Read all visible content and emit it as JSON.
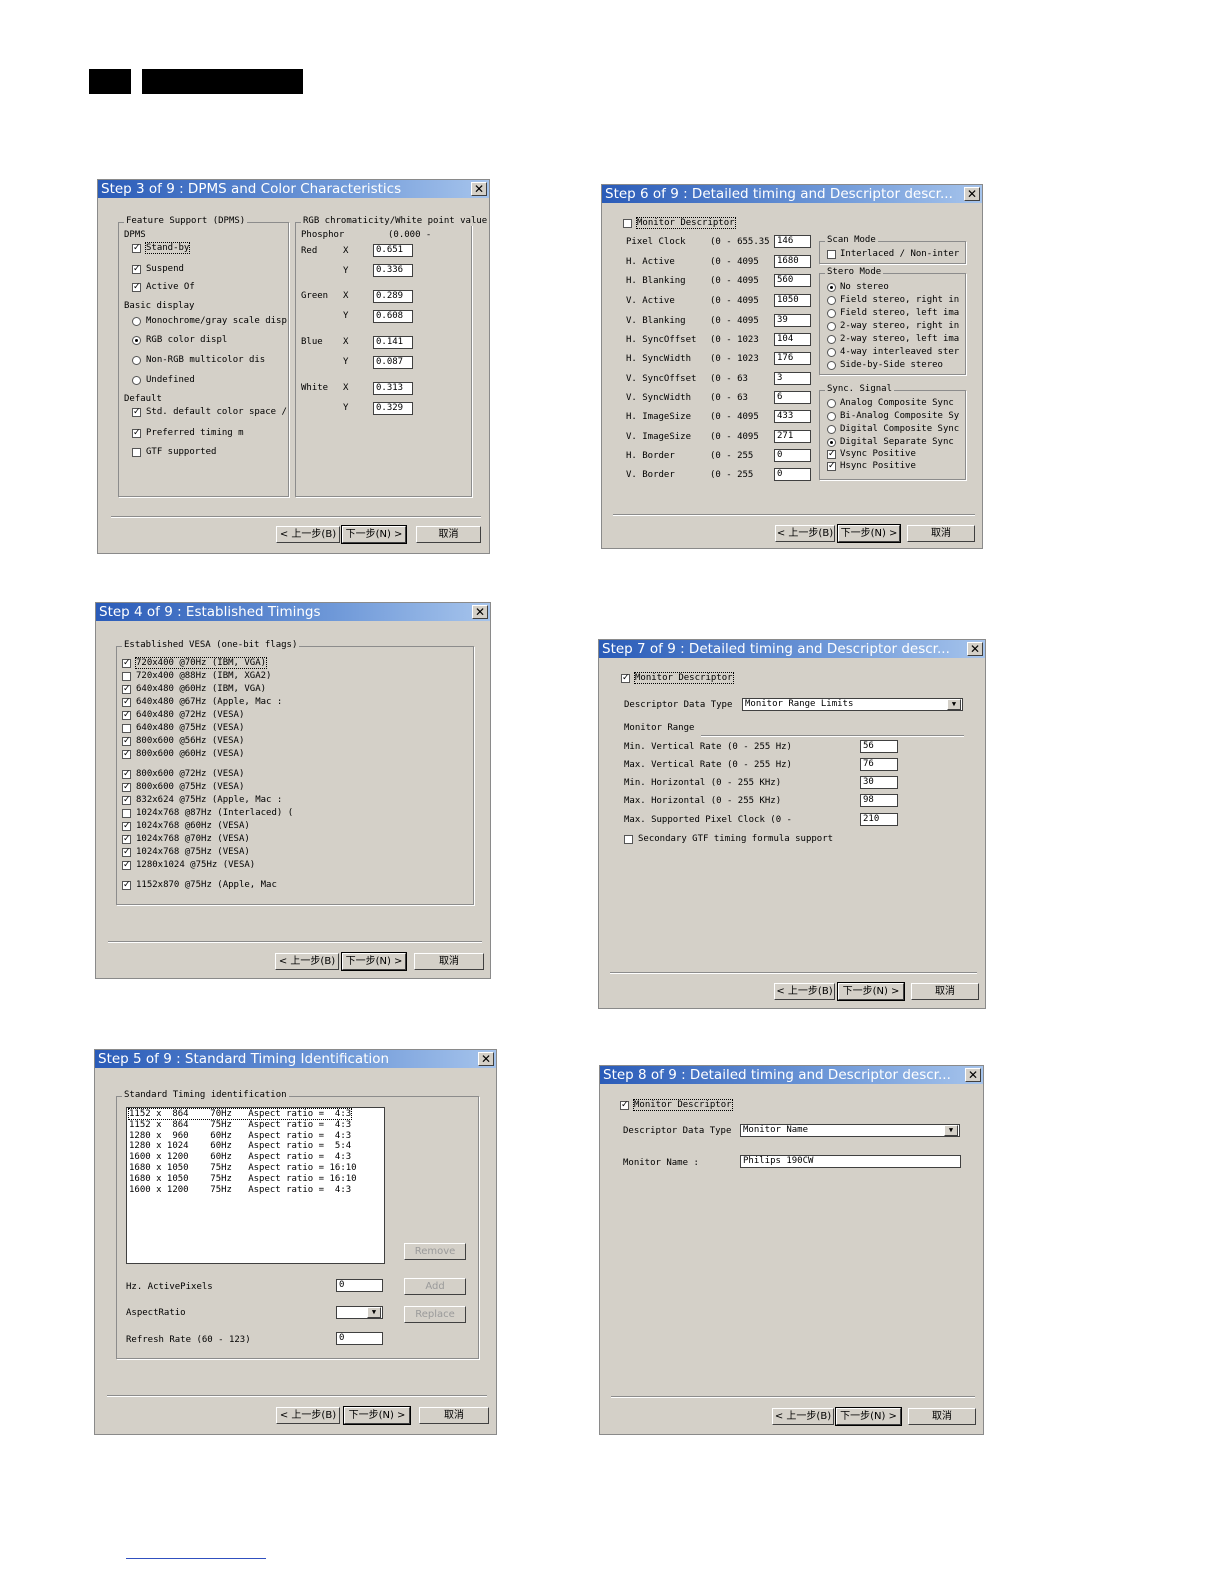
{
  "buttons": {
    "back": "< 上一步(B)",
    "next": "下一步(N) >",
    "cancel": "取消"
  },
  "step3": {
    "title": "Step 3 of 9 : DPMS and Color Characteristics",
    "feature_support": "Feature Support (DPMS)",
    "dpms": "DPMS",
    "standby": "Stand-by",
    "suspend": "Suspend",
    "active_off": "Active Of",
    "basic_display": "Basic display",
    "mono": "Monochrome/gray scale disp",
    "rgb": "RGB color displ",
    "nonrgb": "Non-RGB multicolor dis",
    "undefined": "Undefined",
    "default": "Default",
    "std_default": "Std. default color space /",
    "preferred": "Preferred timing m",
    "gtf": "GTF supported",
    "chroma_group": "RGB chromaticity/White point value",
    "phosphor": "Phosphor",
    "range": "(0.000 -",
    "red": "Red",
    "green": "Green",
    "blue": "Blue",
    "white": "White",
    "x": "X",
    "y": "Y",
    "red_x": "0.651",
    "red_y": "0.336",
    "green_x": "0.289",
    "green_y": "0.608",
    "blue_x": "0.141",
    "blue_y": "0.087",
    "white_x": "0.313",
    "white_y": "0.329"
  },
  "step4": {
    "title": "Step 4 of 9 : Established Timings",
    "group": "Established VESA (one-bit flags)",
    "items": [
      {
        "label": "720x400 @70Hz (IBM, VGA)",
        "checked": true
      },
      {
        "label": "720x400 @88Hz (IBM, XGA2)",
        "checked": false
      },
      {
        "label": "640x480 @60Hz (IBM, VGA)",
        "checked": true
      },
      {
        "label": "640x480 @67Hz (Apple, Mac :",
        "checked": true
      },
      {
        "label": "640x480 @72Hz (VESA)",
        "checked": true
      },
      {
        "label": "640x480 @75Hz (VESA)",
        "checked": false
      },
      {
        "label": "800x600 @56Hz (VESA)",
        "checked": true
      },
      {
        "label": "800x600 @60Hz (VESA)",
        "checked": true
      },
      {
        "label": "800x600 @72Hz (VESA)",
        "checked": true
      },
      {
        "label": "800x600 @75Hz (VESA)",
        "checked": true
      },
      {
        "label": "832x624 @75Hz (Apple, Mac :",
        "checked": true
      },
      {
        "label": "1024x768 @87Hz (Interlaced) (",
        "checked": false
      },
      {
        "label": "1024x768 @60Hz (VESA)",
        "checked": true
      },
      {
        "label": "1024x768 @70Hz (VESA)",
        "checked": true
      },
      {
        "label": "1024x768 @75Hz (VESA)",
        "checked": true
      },
      {
        "label": "1280x1024 @75Hz (VESA)",
        "checked": true
      },
      {
        "label": "1152x870 @75Hz (Apple, Mac",
        "checked": true
      }
    ]
  },
  "step5": {
    "title": "Step 5 of 9 : Standard Timing Identification",
    "group": "Standard Timing identification",
    "rows": [
      "1152 x  864    70Hz   Aspect ratio =  4:3",
      "1152 x  864    75Hz   Aspect ratio =  4:3",
      "1280 x  960    60Hz   Aspect ratio =  4:3",
      "1280 x 1024    60Hz   Aspect ratio =  5:4",
      "1600 x 1200    60Hz   Aspect ratio =  4:3",
      "1680 x 1050    75Hz   Aspect ratio = 16:10",
      "1680 x 1050    75Hz   Aspect ratio = 16:10",
      "1600 x 1200    75Hz   Aspect ratio =  4:3"
    ],
    "remove": "Remove",
    "hz_active": "Hz. ActivePixels",
    "hz_value": "0",
    "add": "Add",
    "aspect": "AspectRatio",
    "replace": "Replace",
    "refresh": "Refresh Rate (60 - 123)",
    "refresh_value": "0"
  },
  "step6": {
    "title": "Step 6 of 9 : Detailed timing and Descriptor descr...",
    "monitor_descriptor": "Monitor Descriptor",
    "params": [
      {
        "label": "Pixel Clock",
        "range": "(0 - 655.35",
        "value": "146"
      },
      {
        "label": "H. Active",
        "range": "(0 - 4095",
        "value": "1680"
      },
      {
        "label": "H. Blanking",
        "range": "(0 - 4095",
        "value": "560"
      },
      {
        "label": "V. Active",
        "range": "(0 - 4095",
        "value": "1050"
      },
      {
        "label": "V. Blanking",
        "range": "(0 - 4095",
        "value": "39"
      },
      {
        "label": "H. SyncOffset",
        "range": "(0 - 1023",
        "value": "104"
      },
      {
        "label": "H. SyncWidth",
        "range": "(0 - 1023",
        "value": "176"
      },
      {
        "label": "V. SyncOffset",
        "range": "(0 - 63",
        "value": "3"
      },
      {
        "label": "V. SyncWidth",
        "range": "(0 - 63",
        "value": "6"
      },
      {
        "label": "H. ImageSize",
        "range": "(0 - 4095",
        "value": "433"
      },
      {
        "label": "V. ImageSize",
        "range": "(0 - 4095",
        "value": "271"
      },
      {
        "label": "H. Border",
        "range": "(0 - 255",
        "value": "0"
      },
      {
        "label": "V. Border",
        "range": "(0 - 255",
        "value": "0"
      }
    ],
    "scan_mode": "Scan Mode",
    "interlaced": "Interlaced / Non-inter",
    "stereo_mode": "Stero Mode",
    "stereo": [
      {
        "label": "No stereo",
        "on": true
      },
      {
        "label": "Field stereo, right in",
        "on": false
      },
      {
        "label": "Field stereo, left ima",
        "on": false
      },
      {
        "label": "2-way stereo, right in",
        "on": false
      },
      {
        "label": "2-way stereo, left ima",
        "on": false
      },
      {
        "label": "4-way interleaved ster",
        "on": false
      },
      {
        "label": "Side-by-Side stereo",
        "on": false
      }
    ],
    "sync_signal": "Sync. Signal",
    "sync": [
      {
        "label": "Analog Composite Sync",
        "on": false
      },
      {
        "label": "Bi-Analog Composite Sy",
        "on": false
      },
      {
        "label": "Digital Composite Sync",
        "on": false
      },
      {
        "label": "Digital Separate Sync",
        "on": true
      }
    ],
    "vsync": "Vsync Positive",
    "hsync": "Hsync Positive"
  },
  "step7": {
    "title": "Step 7 of 9 : Detailed timing and Descriptor descr...",
    "monitor_descriptor": "Monitor Descriptor",
    "data_type_label": "Descriptor Data Type",
    "data_type_value": "Monitor Range Limits",
    "range_header": "Monitor Range",
    "fields": [
      {
        "label": "Min. Vertical Rate   (0 - 255 Hz)",
        "value": "56"
      },
      {
        "label": "Max. Vertical Rate  (0 - 255 Hz)",
        "value": "76"
      },
      {
        "label": "Min. Horizontal   (0 - 255 KHz)",
        "value": "30"
      },
      {
        "label": "Max. Horizontal  (0 - 255 KHz)",
        "value": "98"
      },
      {
        "label": "Max. Supported Pixel Clock  (0 -",
        "value": "210"
      }
    ],
    "secondary_gtf": "Secondary GTF timing formula support"
  },
  "step8": {
    "title": "Step 8 of 9 : Detailed timing and Descriptor descr...",
    "monitor_descriptor": "Monitor Descriptor",
    "data_type_label": "Descriptor Data Type",
    "data_type_value": "Monitor Name",
    "name_label": "Monitor Name :",
    "name_value": "Philips 190CW"
  }
}
